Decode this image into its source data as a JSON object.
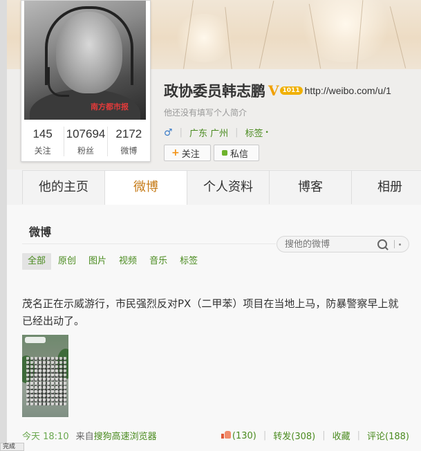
{
  "profile": {
    "name": "政协委员韩志鹏",
    "verified_mark": "V",
    "level_badge": "1011",
    "weibo_url": "http://weibo.com/u/1",
    "bio": "他还没有填写个人简介",
    "gender_icon": "male-icon",
    "location": "广东 广州",
    "tags_label": "标签",
    "tags_dot": "•",
    "avatar_watermark": "南方都市报",
    "stats": [
      {
        "value": "145",
        "label": "关注"
      },
      {
        "value": "107694",
        "label": "粉丝"
      },
      {
        "value": "2172",
        "label": "微博"
      }
    ],
    "follow_button": {
      "icon": "+",
      "label": "关注"
    },
    "message_button": {
      "label": "私信"
    }
  },
  "tabs": [
    {
      "label": "他的主页"
    },
    {
      "label": "微博",
      "active": true
    },
    {
      "label": "个人资料"
    },
    {
      "label": "博客"
    },
    {
      "label": "相册"
    }
  ],
  "weibo_section": {
    "title": "微博",
    "search_placeholder": "搜他的微博",
    "search_divider": "|",
    "filters": [
      {
        "label": "全部",
        "active": true
      },
      {
        "label": "原创"
      },
      {
        "label": "图片"
      },
      {
        "label": "视频"
      },
      {
        "label": "音乐"
      },
      {
        "label": "标签"
      }
    ]
  },
  "post": {
    "text": "茂名正在示威游行，市民强烈反对PX（二甲苯）项目在当地上马，防暴警察早上就已经出动了。",
    "time": "今天 18:10",
    "from_prefix": "来自",
    "source": "搜狗高速浏览器",
    "likes": "(130)",
    "repost": "转发(308)",
    "favorite": "收藏",
    "comment": "评论(188)"
  },
  "browser_status": "完成",
  "colors": {
    "link_green": "#4a8b1f",
    "active_tab": "#c67c1a",
    "verified_gold": "#f0a000"
  }
}
